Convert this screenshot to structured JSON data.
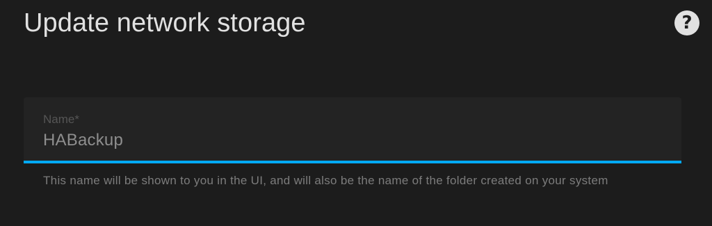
{
  "dialog": {
    "title": "Update network storage",
    "help_icon": "question-circle-icon",
    "help_glyph": "?"
  },
  "name_field": {
    "label": "Name*",
    "value": "HABackup",
    "helper_text": "This name will be shown to you in the UI, and will also be the name of the folder created on your system"
  },
  "colors": {
    "background": "#1c1c1c",
    "field_background": "#232323",
    "accent": "#03a9f4",
    "title_text": "#e1e1e1"
  }
}
